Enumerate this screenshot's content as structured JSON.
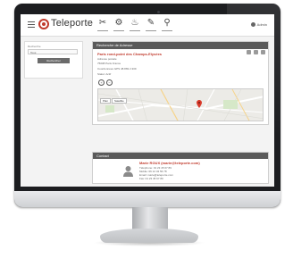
{
  "app": {
    "brand": "Teleporte",
    "user_label": "Admin"
  },
  "nav": {
    "tools": [
      {
        "icon": "scissors-icon",
        "glyph": "✂"
      },
      {
        "icon": "gear-icon",
        "glyph": "⚙"
      },
      {
        "icon": "flask-icon",
        "glyph": "♨"
      },
      {
        "icon": "wrench-icon",
        "glyph": "✎"
      },
      {
        "icon": "pin-icon",
        "glyph": "⚲"
      }
    ]
  },
  "left_panel": {
    "label": "Recherche",
    "select_value": "Tous",
    "search_button": "Rechercher"
  },
  "detail": {
    "header_title": "Recherche de Adresse",
    "poi_name": "Paris rond-point des Champs-Elysées",
    "lines": [
      "Adresse postale",
      "75008 Paris France",
      "Coordonnées GPS 48.869 2.309",
      "Statut: Actif"
    ],
    "map_tabs": [
      "Plan",
      "Satellite"
    ]
  },
  "contact": {
    "header_title": "Contact",
    "name": "Marie ROUX (marie@teleporte.com)",
    "lines": [
      "Téléphone: 01 23 45 67 89",
      "Mobile: 06 12 34 56 78",
      "Email: marie@teleporte.com",
      "Fax: 01 23 45 67 80"
    ]
  },
  "colors": {
    "brand_red": "#c0392b",
    "header_gray": "#5a5a5a",
    "bezel": "#1c1d20"
  }
}
